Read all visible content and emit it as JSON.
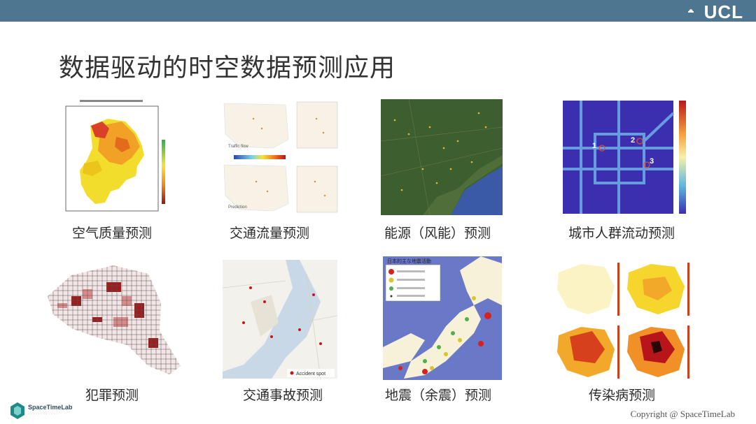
{
  "header": {
    "brand": "UCL"
  },
  "slide": {
    "title": "数据驱动的时空数据预测应用"
  },
  "tiles": [
    {
      "caption": "空气质量预测"
    },
    {
      "caption": "交通流量预测",
      "label_a": "Traffic flow",
      "label_b": "Prediction"
    },
    {
      "caption": "能源（风能）预测"
    },
    {
      "caption": "城市人群流动预测",
      "markers": [
        "1",
        "2",
        "3"
      ]
    },
    {
      "caption": "犯罪预测"
    },
    {
      "caption": "交通事故预测",
      "legend": "Accident spot"
    },
    {
      "caption": "地震（余震）预测",
      "map_title": "日本的主な地震活動"
    },
    {
      "caption": "传染病预测"
    }
  ],
  "footer": {
    "copyright": "Copyright @ SpaceTimeLab",
    "logo": "SpaceTimeLab"
  },
  "colors": {
    "topbar": "#4f7690",
    "title": "#333333"
  }
}
